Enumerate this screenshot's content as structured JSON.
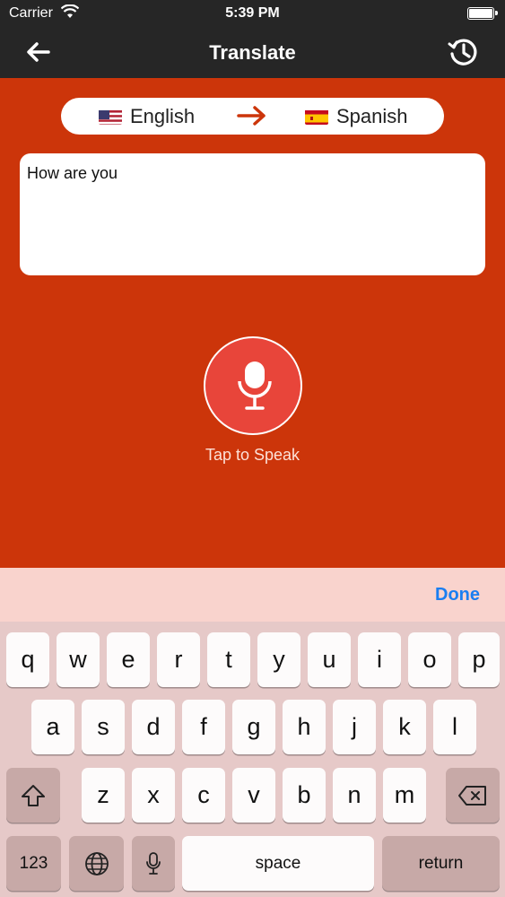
{
  "status_bar": {
    "carrier": "Carrier",
    "time": "5:39 PM"
  },
  "nav": {
    "title": "Translate",
    "back_icon": "arrow-left-icon",
    "history_icon": "history-icon"
  },
  "language_bar": {
    "source": {
      "name": "English",
      "flag": "us-flag-icon"
    },
    "target": {
      "name": "Spanish",
      "flag": "spain-flag-icon"
    },
    "arrow_icon": "arrow-right-icon",
    "arrow_color": "#cc350a"
  },
  "input": {
    "value": "How are you"
  },
  "mic": {
    "label": "Tap to Speak",
    "icon": "microphone-icon",
    "color": "#e8453a"
  },
  "keyboard": {
    "done_label": "Done",
    "row1": [
      "q",
      "w",
      "e",
      "r",
      "t",
      "y",
      "u",
      "i",
      "o",
      "p"
    ],
    "row2": [
      "a",
      "s",
      "d",
      "f",
      "g",
      "h",
      "j",
      "k",
      "l"
    ],
    "row3": [
      "z",
      "x",
      "c",
      "v",
      "b",
      "n",
      "m"
    ],
    "numbers_label": "123",
    "space_label": "space",
    "return_label": "return"
  },
  "colors": {
    "background": "#cc350a",
    "bar": "#262626",
    "done": "#1a7ef1"
  }
}
